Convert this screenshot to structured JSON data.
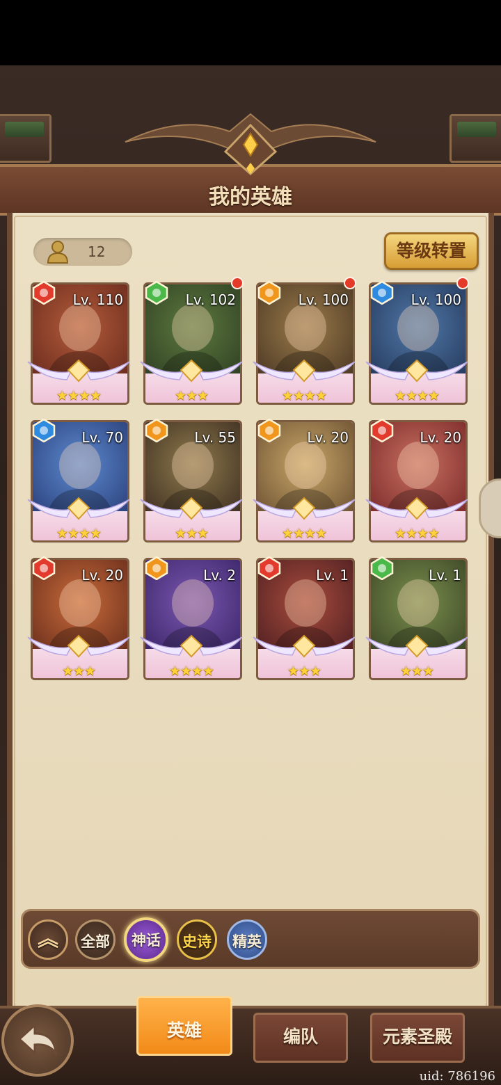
{
  "header": {
    "title": "我的英雄"
  },
  "toolbar": {
    "hero_count": "12",
    "level_transfer_label": "等级转置"
  },
  "heroes": [
    {
      "level": "Lv. 110",
      "element": "fire",
      "element_color": "#e23b2e",
      "stars": 4,
      "bg": [
        "#b45c3a",
        "#6a2b1e"
      ],
      "new_dot": false
    },
    {
      "level": "Lv. 102",
      "element": "nature",
      "element_color": "#4bb84a",
      "stars": 3,
      "bg": [
        "#5d7a3e",
        "#2f3f24"
      ],
      "new_dot": true
    },
    {
      "level": "Lv. 100",
      "element": "light",
      "element_color": "#f0961c",
      "stars": 4,
      "bg": [
        "#9b7b4a",
        "#4b3824"
      ],
      "new_dot": true
    },
    {
      "level": "Lv. 100",
      "element": "water",
      "element_color": "#2f8be0",
      "stars": 4,
      "bg": [
        "#5078a8",
        "#25395c"
      ],
      "new_dot": true
    },
    {
      "level": "Lv. 70",
      "element": "water",
      "element_color": "#2f8be0",
      "stars": 4,
      "bg": [
        "#5d8ad0",
        "#2a3f79"
      ],
      "new_dot": false
    },
    {
      "level": "Lv. 55",
      "element": "light",
      "element_color": "#f0961c",
      "stars": 3,
      "bg": [
        "#8f7a4c",
        "#3e2f22"
      ],
      "new_dot": false
    },
    {
      "level": "Lv. 20",
      "element": "light",
      "element_color": "#f0961c",
      "stars": 4,
      "bg": [
        "#c9a86a",
        "#6d5232"
      ],
      "new_dot": false
    },
    {
      "level": "Lv. 20",
      "element": "fire",
      "element_color": "#e23b2e",
      "stars": 4,
      "bg": [
        "#c87060",
        "#7b2a2a"
      ],
      "new_dot": false
    },
    {
      "level": "Lv. 20",
      "element": "fire",
      "element_color": "#e23b2e",
      "stars": 3,
      "bg": [
        "#c86b3a",
        "#6a2e1c"
      ],
      "new_dot": false
    },
    {
      "level": "Lv. 2",
      "element": "light",
      "element_color": "#f0961c",
      "stars": 4,
      "bg": [
        "#7b56b0",
        "#3a2668"
      ],
      "new_dot": false
    },
    {
      "level": "Lv. 1",
      "element": "fire",
      "element_color": "#e23b2e",
      "stars": 3,
      "bg": [
        "#a84c3c",
        "#4f1f22"
      ],
      "new_dot": false
    },
    {
      "level": "Lv. 1",
      "element": "nature",
      "element_color": "#4bb84a",
      "stars": 3,
      "bg": [
        "#7c8f4e",
        "#3b4626"
      ],
      "new_dot": false
    }
  ],
  "filters": {
    "all": "全部",
    "myth": "神话",
    "epic": "史诗",
    "elite": "精英"
  },
  "nav": {
    "heroes": "英雄",
    "team": "编队",
    "temple": "元素圣殿"
  },
  "uid": "uid: 786196"
}
